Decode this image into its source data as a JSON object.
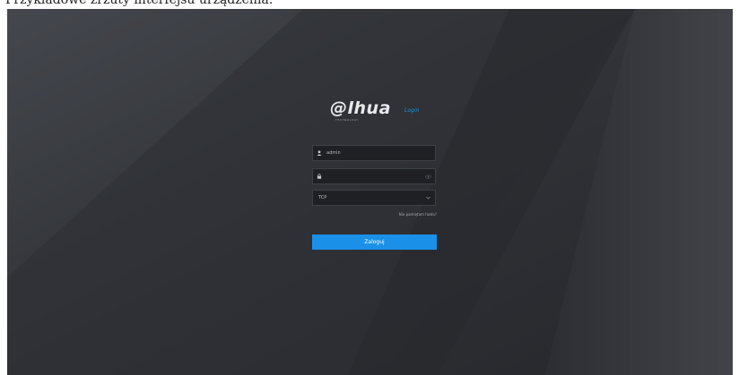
{
  "caption": "Przykładowe zrzuty interfejsu urządzenia:",
  "logo": {
    "brand": "@lhua",
    "tagline": "TECHNOLOGY",
    "login_label": "Login"
  },
  "form": {
    "username": {
      "value": "admin",
      "icon": "user-icon"
    },
    "password": {
      "value": "",
      "icon": "lock-icon",
      "toggle_icon": "eye-icon"
    },
    "select": {
      "value": "TCP",
      "icon": "chevron-down-icon"
    },
    "forgot_label": "Nie pamiętam hasła?",
    "submit_label": "Zaloguj"
  },
  "colors": {
    "background": "#2b2d31",
    "accent": "#1a90e8",
    "field": "#1e2023"
  }
}
